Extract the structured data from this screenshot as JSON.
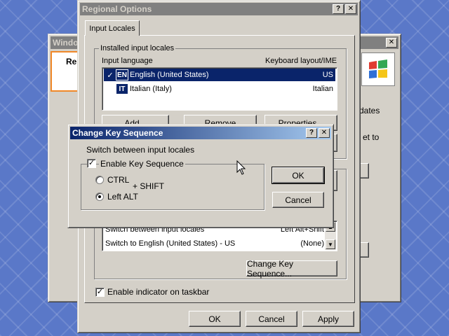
{
  "bg_window": {
    "title_partial": "Window",
    "label_partial": "Re",
    "text_fragment_1": "dates",
    "text_fragment_2": "et to"
  },
  "regional": {
    "title": "Regional Options",
    "help_glyph": "?",
    "close_glyph": "✕",
    "tab": "Input Locales",
    "installed_group": "Installed input locales",
    "col_language": "Input language",
    "col_layout": "Keyboard layout/IME",
    "locales": [
      {
        "check": "✓",
        "code": "EN",
        "language": "English (United States)",
        "layout": "US",
        "selected": true
      },
      {
        "check": "",
        "code": "IT",
        "language": "Italian (Italy)",
        "layout": "Italian",
        "selected": false
      }
    ],
    "add_label": "Add...",
    "remove_label": "Remove",
    "properties_label": "Properties...",
    "hotkeys": [
      {
        "action": "Switch between input locales",
        "key": "Left Alt+Shift"
      },
      {
        "action": "Switch to English (United States) - US",
        "key": "(None)"
      }
    ],
    "change_key_sequence": "Change Key Sequence...",
    "enable_indicator": "Enable indicator on taskbar",
    "ok": "OK",
    "cancel": "Cancel",
    "apply": "Apply"
  },
  "dialog": {
    "title": "Change Key Sequence",
    "help_glyph": "?",
    "close_glyph": "✕",
    "prompt": "Switch between input locales",
    "enable_label": "Enable Key Sequence",
    "ctrl_label": "CTRL",
    "left_alt_label": "Left ALT",
    "plus_shift": "+  SHIFT",
    "ok": "OK",
    "cancel": "Cancel"
  },
  "icons": [
    "windows-logo-icon",
    "mouse-cursor-icon",
    "flag-icon",
    "checkmark-icon"
  ],
  "colors": {
    "desktop": "#5a78c8",
    "face": "#d4d0c8",
    "active_title": "#0a246a",
    "inactive_title": "#808080",
    "selection": "#0a246a",
    "orange_frame": "#f08828"
  }
}
